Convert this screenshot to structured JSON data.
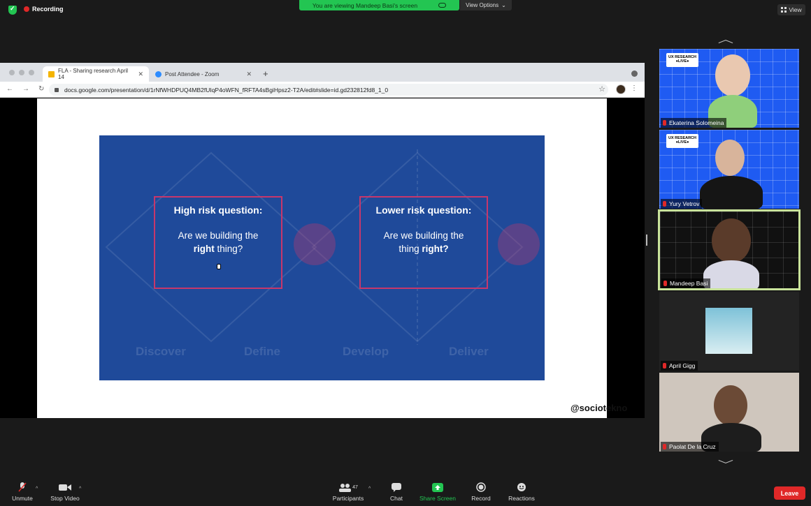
{
  "topbar": {
    "recording": "Recording",
    "viewing_banner": "You are viewing Mandeep Basi's screen",
    "view_options": "View Options",
    "view_button": "View"
  },
  "browser": {
    "tabs": [
      {
        "label": "FLA - Sharing research April 14"
      },
      {
        "label": "Post Attendee - Zoom"
      }
    ],
    "new_tab": "+",
    "url": "docs.google.com/presentation/d/1rNfWHDPUQ4MB2fUIqP4oWFN_fRFTA4sBgiHpsz2-T2A/edit#slide=id.gd232812fd8_1_0"
  },
  "slide": {
    "box_a": {
      "heading": "High risk question:",
      "line1": "Are we building the",
      "bold": "right",
      "tail": " thing?"
    },
    "box_b": {
      "heading": "Lower risk question:",
      "line1": "Are we building the",
      "pre": "thing ",
      "bold": "right?"
    },
    "phases": [
      "Discover",
      "Define",
      "Develop",
      "Deliver"
    ],
    "handle": "@sociotekno"
  },
  "participants": [
    {
      "name": "Ekaterina Solomeina"
    },
    {
      "name": "Yury Vetrov"
    },
    {
      "name": "Mandeep Basi"
    },
    {
      "name": "April Gigg"
    },
    {
      "name": "Paolat De la Cruz"
    }
  ],
  "tile_labels": {
    "ux": "UX RESEARCH ●LIVE●"
  },
  "toolbar": {
    "unmute": "Unmute",
    "stop_video": "Stop Video",
    "participants": "Participants",
    "participants_count": "47",
    "chat": "Chat",
    "share_screen": "Share Screen",
    "record": "Record",
    "reactions": "Reactions",
    "leave": "Leave"
  },
  "colors": {
    "green": "#23c552",
    "red": "#e02828",
    "slide_blue": "#1f4a9a",
    "box_border": "#c7376b"
  }
}
